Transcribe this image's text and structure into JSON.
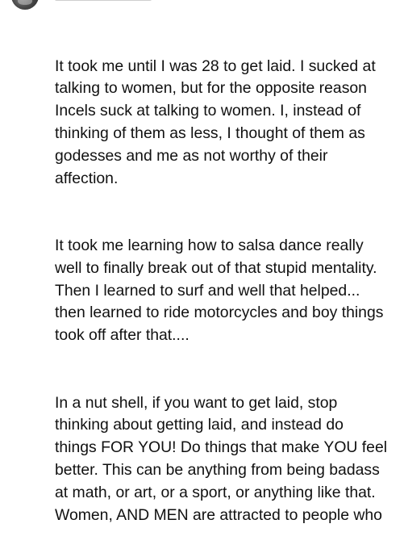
{
  "comment": {
    "author_avatar_icon": "user-avatar-icon",
    "paragraphs": [
      "It took me until I was 28 to get laid. I sucked at\ntalking to women, but for the opposite reason\nIncels suck at talking to women. I, instead of\nthinking of them as less, I thought of them as\ngodesses and me as not worthy of their\naffection.",
      "It took me learning how to salsa dance really\nwell to finally break out of that stupid mentality.\nThen I learned to surf and well that helped...\nthen learned to ride motorcycles and boy things\ntook off after that....",
      "In a nut shell, if you want to get laid, stop\nthinking about getting laid, and instead do\nthings FOR YOU! Do things that make YOU feel\nbetter. This can be anything from being badass\nat math, or art, or a sport, or anything like that.\nWomen, AND MEN are attracted to people who"
    ]
  }
}
